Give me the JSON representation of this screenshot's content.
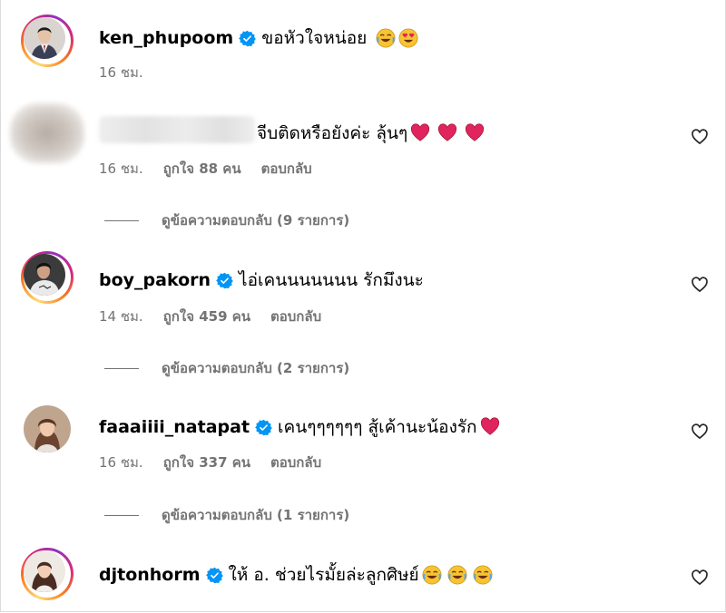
{
  "colors": {
    "secondary_text": "#737373",
    "verified_blue": "#0095f6",
    "heart_red": "#e0245e"
  },
  "caption": {
    "username": "ken_phupoom",
    "text": "ขอหัวใจหน่อย",
    "emojis": [
      "joy-emoji",
      "heart-eyes-emoji"
    ],
    "time": "16 ชม."
  },
  "comments": [
    {
      "username": "",
      "text": "จีบติดหรือยังค่ะ ลุ้นๆ",
      "emojis": [
        "red-heart-emoji",
        "red-heart-emoji",
        "red-heart-emoji"
      ],
      "time": "16 ชม.",
      "likes": "ถูกใจ 88 คน",
      "reply_label": "ตอบกลับ",
      "view_replies": "ดูข้อความตอบกลับ (9 รายการ)"
    },
    {
      "username": "boy_pakorn",
      "text": "ไอ่เคนนนนนนน รักมึงนะ",
      "emojis": [],
      "time": "14 ชม.",
      "likes": "ถูกใจ 459 คน",
      "reply_label": "ตอบกลับ",
      "view_replies": "ดูข้อความตอบกลับ (2 รายการ)"
    },
    {
      "username": "faaaiiii_natapat",
      "text": "เคนๆๆๆๆๆๆ สู้เค้านะน้องรัก",
      "emojis": [
        "red-heart-emoji"
      ],
      "time": "16 ชม.",
      "likes": "ถูกใจ 337 คน",
      "reply_label": "ตอบกลับ",
      "view_replies": "ดูข้อความตอบกลับ (1 รายการ)"
    },
    {
      "username": "djtonhorm",
      "text": "ให้ อ. ช่วยไรมั้ยล่ะลูกศิษย์",
      "emojis": [
        "joy-emoji",
        "joy-emoji",
        "joy-emoji"
      ]
    }
  ]
}
